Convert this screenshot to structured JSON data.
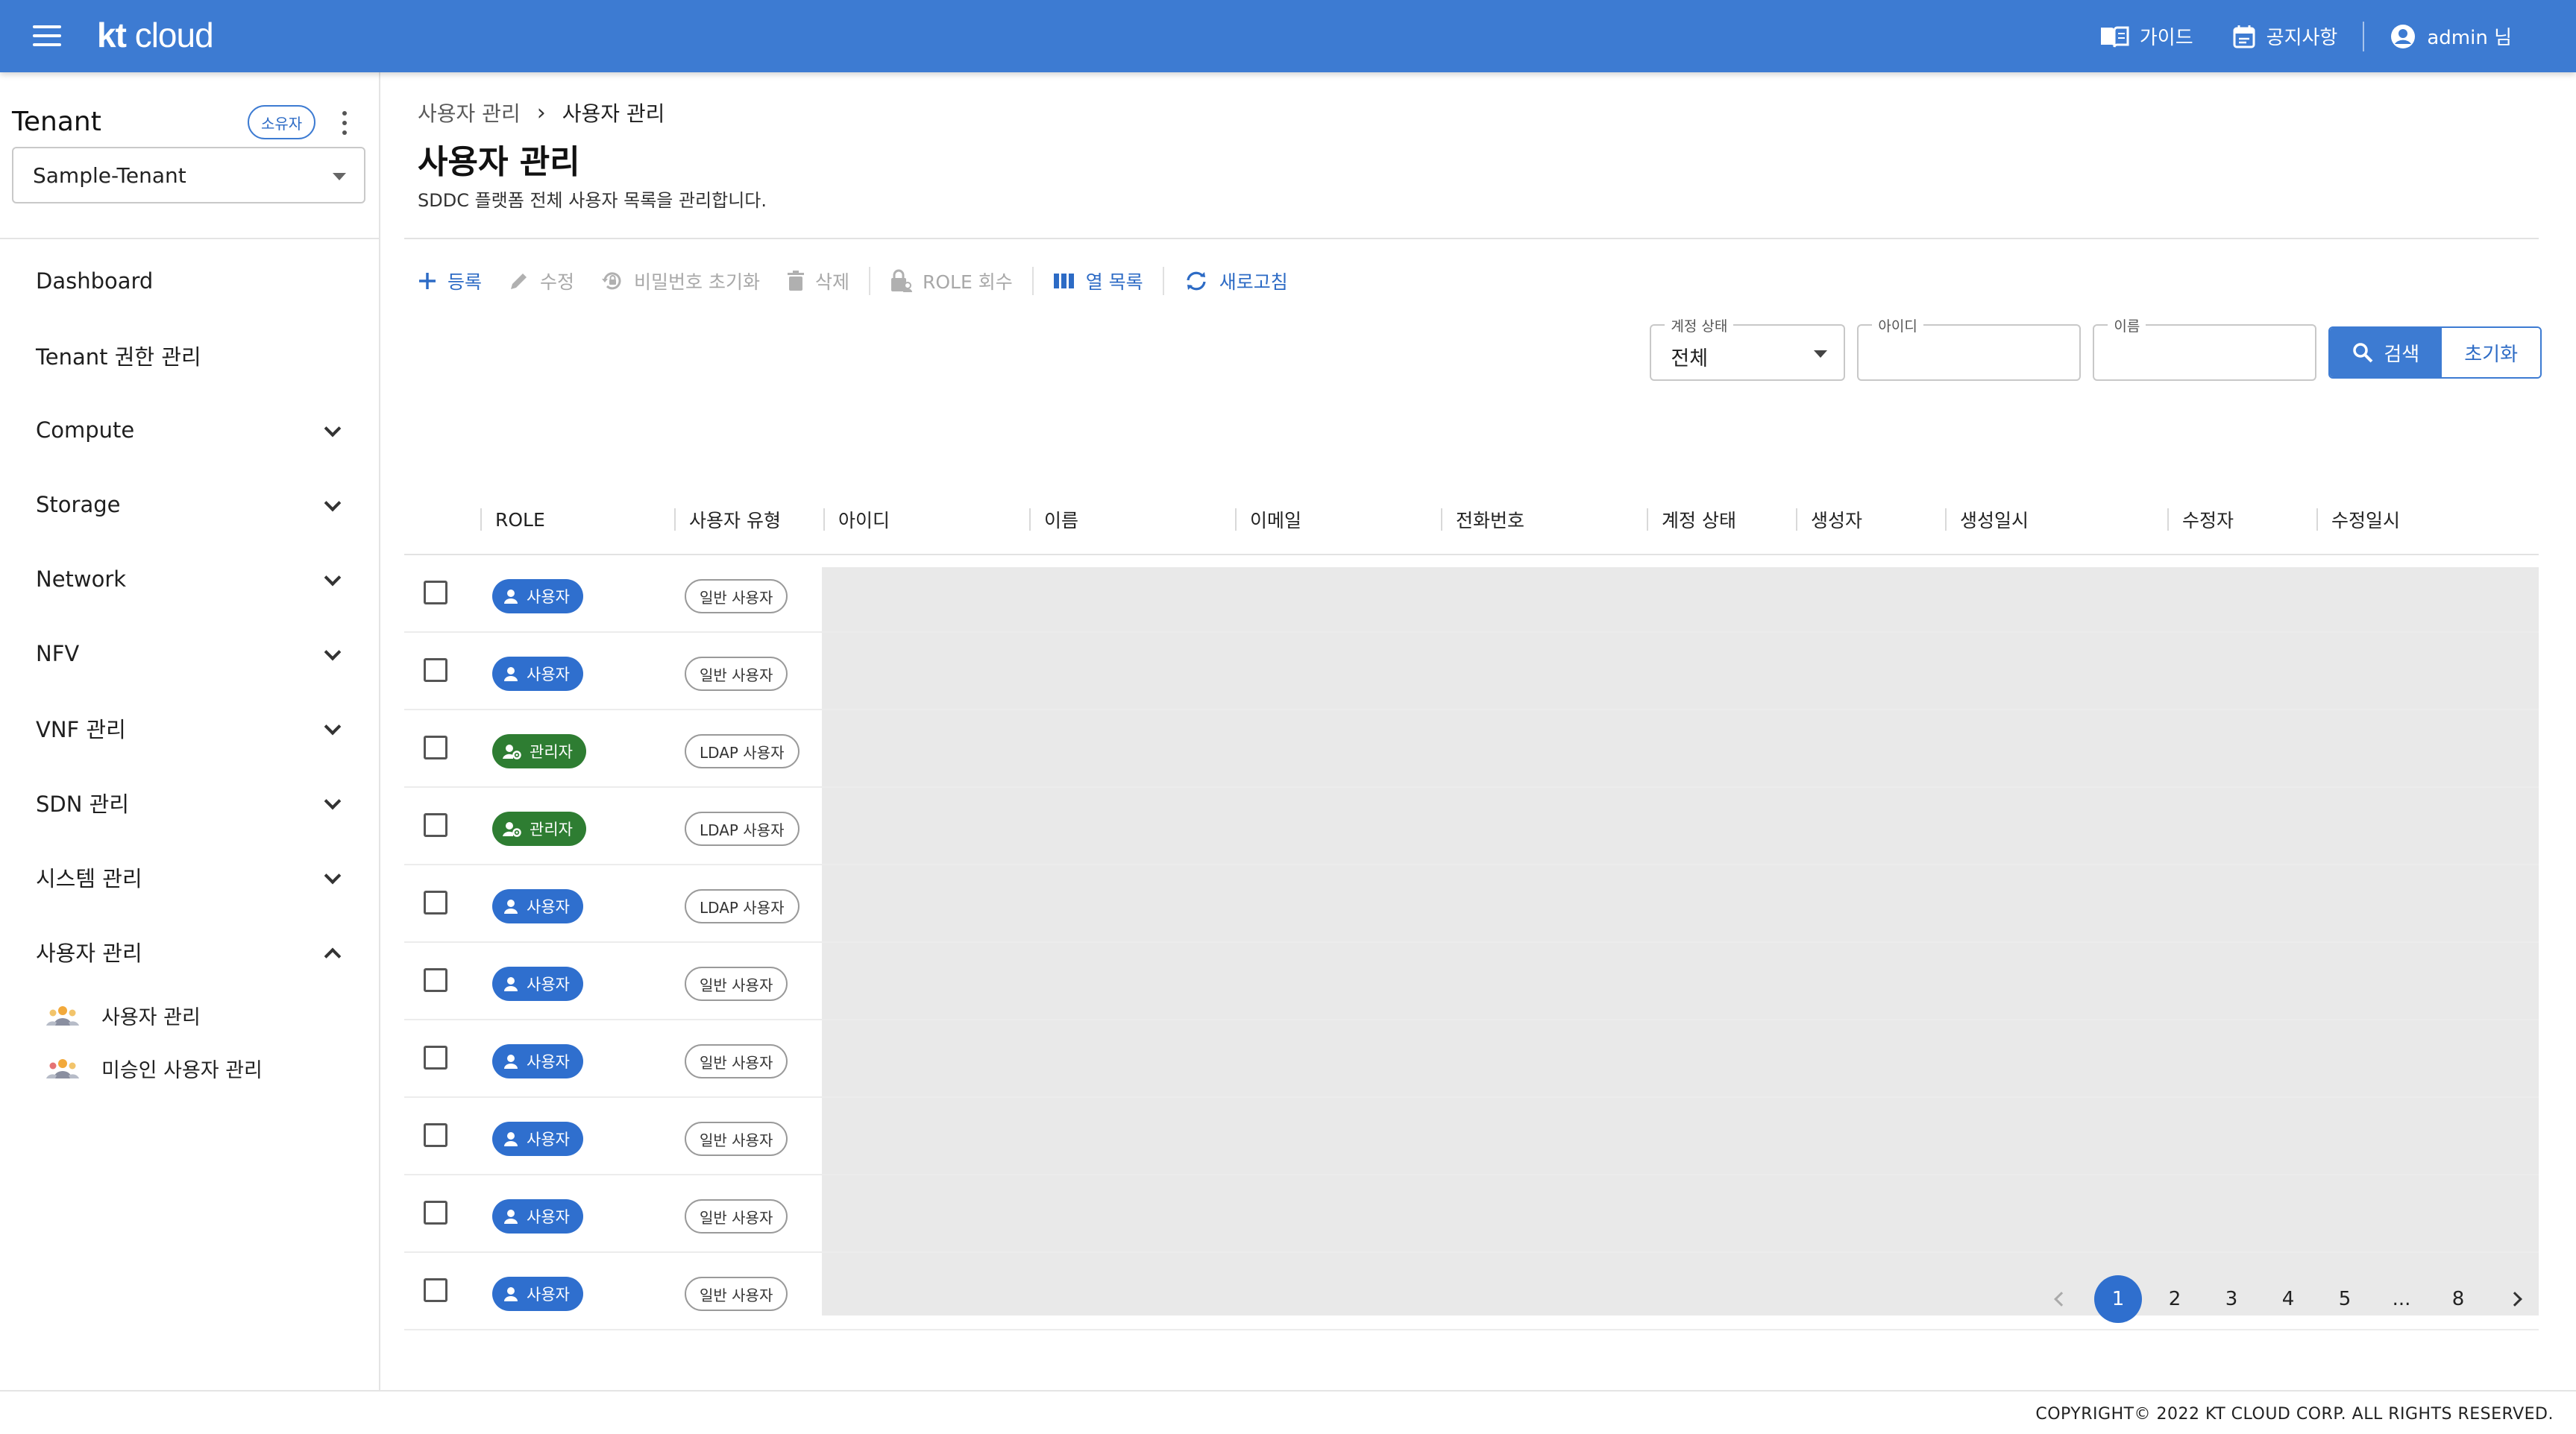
{
  "topbar": {
    "logo_kt": "kt",
    "logo_cloud": "cloud",
    "guide": "가이드",
    "notice": "공지사항",
    "user": "admin 님"
  },
  "sidebar": {
    "tenant_title": "Tenant",
    "owner_badge": "소유자",
    "tenant_value": "Sample-Tenant",
    "items": [
      {
        "label": "Dashboard"
      },
      {
        "label": "Tenant 권한 관리"
      },
      {
        "label": "Compute"
      },
      {
        "label": "Storage"
      },
      {
        "label": "Network"
      },
      {
        "label": "NFV"
      },
      {
        "label": "VNF 관리"
      },
      {
        "label": "SDN 관리"
      },
      {
        "label": "시스템 관리"
      },
      {
        "label": "사용자 관리"
      }
    ],
    "sub_items": [
      {
        "label": "사용자 관리"
      },
      {
        "label": "미승인 사용자 관리"
      }
    ]
  },
  "main": {
    "breadcrumb": [
      "사용자 관리",
      "사용자 관리"
    ],
    "title": "사용자 관리",
    "description": "SDDC 플랫폼 전체 사용자 목록을 관리합니다.",
    "toolbar": {
      "add": "등록",
      "edit": "수정",
      "reset_password": "비밀번호 초기화",
      "delete": "삭제",
      "role_revoke": "ROLE 회수",
      "columns": "열 목록",
      "refresh": "새로고침"
    },
    "search": {
      "status_label": "계정 상태",
      "status_value": "전체",
      "id_label": "아이디",
      "name_label": "이름",
      "search_button": "검색",
      "reset_button": "초기화"
    },
    "table": {
      "headers": [
        "ROLE",
        "사용자 유형",
        "아이디",
        "이름",
        "이메일",
        "전화번호",
        "계정 상태",
        "생성자",
        "생성일시",
        "수정자",
        "수정일시"
      ],
      "rows": [
        {
          "role": "사용자",
          "type": "일반 사용자"
        },
        {
          "role": "사용자",
          "type": "일반 사용자"
        },
        {
          "role": "관리자",
          "type": "LDAP 사용자"
        },
        {
          "role": "관리자",
          "type": "LDAP 사용자"
        },
        {
          "role": "사용자",
          "type": "LDAP 사용자"
        },
        {
          "role": "사용자",
          "type": "일반 사용자"
        },
        {
          "role": "사용자",
          "type": "일반 사용자"
        },
        {
          "role": "사용자",
          "type": "일반 사용자"
        },
        {
          "role": "사용자",
          "type": "일반 사용자"
        },
        {
          "role": "사용자",
          "type": "일반 사용자"
        }
      ]
    },
    "pagination": {
      "pages": [
        "1",
        "2",
        "3",
        "4",
        "5",
        "...",
        "8"
      ],
      "current": "1"
    }
  },
  "footer": {
    "copyright": "COPYRIGHT© 2022 KT CLOUD CORP. ALL RIGHTS RESERVED."
  },
  "colors": {
    "brand": "#3d7bd2",
    "user_role": "#2f6fce",
    "admin_role": "#2e7d32"
  }
}
